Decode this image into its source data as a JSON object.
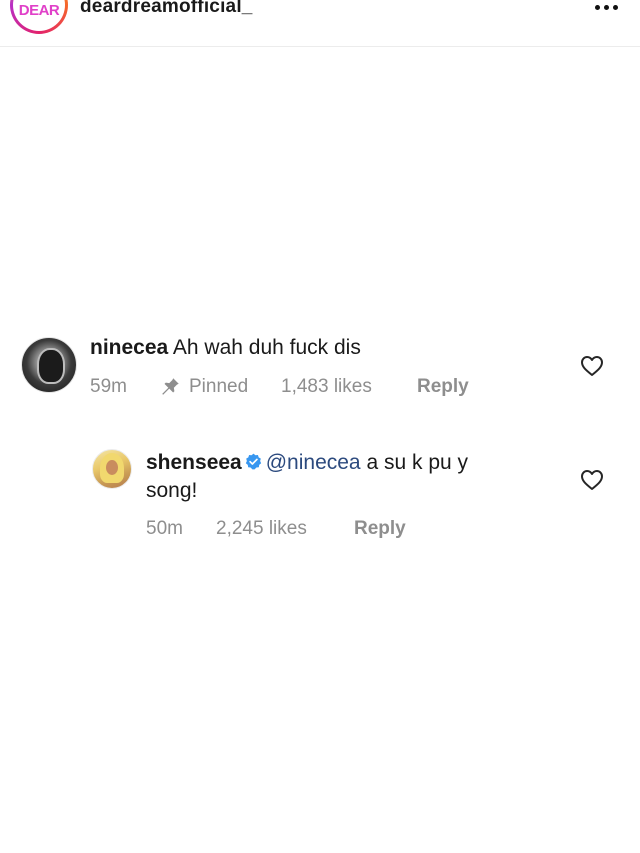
{
  "header": {
    "logo_text": "DEAR",
    "username": "deardreamofficial_",
    "more_icon": "ellipsis-horizontal-icon"
  },
  "comments": [
    {
      "username": "ninecea",
      "text": "Ah wah duh fuck dis",
      "time": "59m",
      "pinned_label": "Pinned",
      "likes": "1,483 likes",
      "reply_label": "Reply",
      "like_icon": "heart-outline-icon"
    },
    {
      "username": "shenseea",
      "verified": true,
      "mention": "@ninecea",
      "text_line1": "a su  k pu  y",
      "text_line2": "song!",
      "time": "50m",
      "likes": "2,245 likes",
      "reply_label": "Reply",
      "like_icon": "heart-outline-icon"
    }
  ],
  "colors": {
    "text": "#1a1a1a",
    "meta": "#8e8e8e",
    "mention": "#2c4a7e",
    "verified": "#3897f0"
  }
}
